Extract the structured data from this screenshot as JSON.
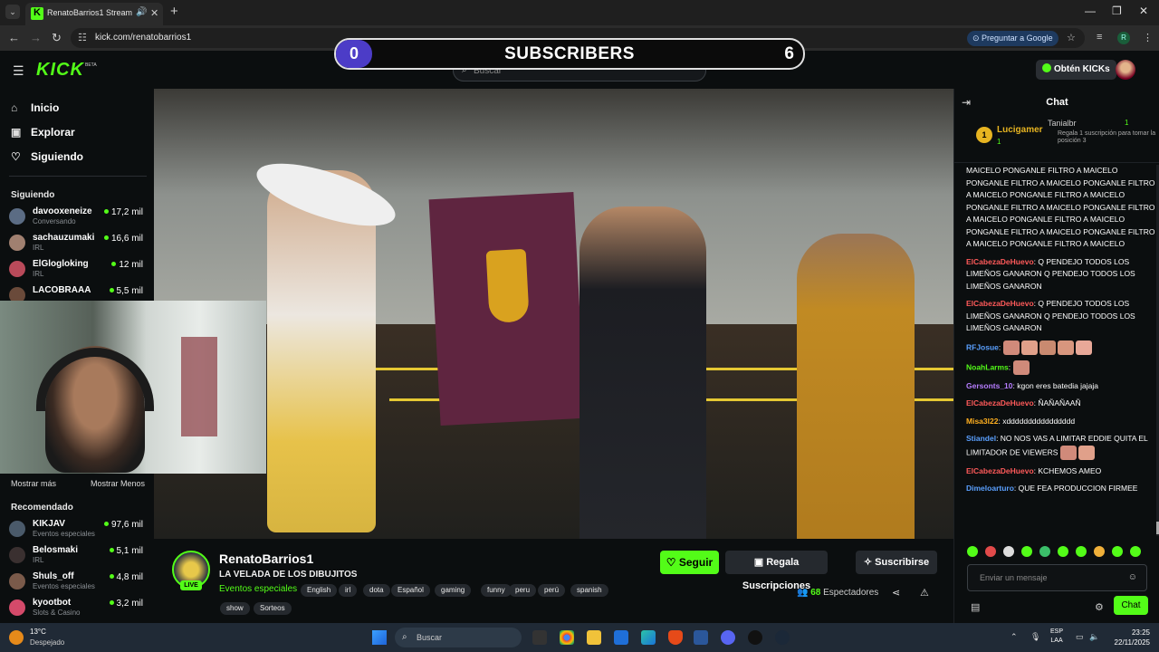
{
  "browser": {
    "tab_title": "RenatoBarrios1 Stream - W",
    "url": "kick.com/renatobarrios1",
    "google_button": "Preguntar a Google",
    "profile_initial": "R"
  },
  "header": {
    "logo": "KICK",
    "logo_badge": "BETA",
    "search_placeholder": "Buscar",
    "kicks_button": "Obtén KICKs"
  },
  "subscriber_goal": {
    "current": "0",
    "label": "SUBSCRIBERS",
    "goal": "6"
  },
  "sidebar": {
    "nav": [
      {
        "label": "Inicio",
        "icon": "home-icon"
      },
      {
        "label": "Explorar",
        "icon": "compass-icon"
      },
      {
        "label": "Siguiendo",
        "icon": "heart-icon"
      }
    ],
    "following_title": "Siguiendo",
    "following": [
      {
        "name": "davooxeneize",
        "category": "Conversando",
        "viewers": "17,2 mil",
        "color": "#5b6c84"
      },
      {
        "name": "sachauzumaki",
        "category": "IRL",
        "viewers": "16,6 mil",
        "color": "#a08070"
      },
      {
        "name": "ElGlogloking",
        "category": "IRL",
        "viewers": "12 mil",
        "color": "#b94a5a"
      },
      {
        "name": "LACOBRAAA",
        "category": "",
        "viewers": "5,5 mil",
        "color": "#6a4a3a"
      }
    ],
    "show_more": "Mostrar más",
    "show_less": "Mostrar Menos",
    "recommended_title": "Recomendado",
    "recommended": [
      {
        "name": "KIKJAV",
        "category": "Eventos especiales",
        "viewers": "97,6 mil",
        "color": "#4a5a6a"
      },
      {
        "name": "Belosmaki",
        "category": "IRL",
        "viewers": "5,1 mil",
        "color": "#3a3030"
      },
      {
        "name": "Shuls_off",
        "category": "Eventos especiales",
        "viewers": "4,8 mil",
        "color": "#7a5a4a"
      },
      {
        "name": "kyootbot",
        "category": "Slots & Casino",
        "viewers": "3,2 mil",
        "color": "#d44a6a"
      }
    ]
  },
  "stream": {
    "channel": "RenatoBarrios1",
    "live": "LIVE",
    "title": "LA VELADA DE LOS DIBUJITOS",
    "category": "Eventos especiales",
    "tags": [
      "English",
      "irl",
      "dota",
      "Español",
      "gaming",
      "funny",
      "peru",
      "perú",
      "spanish",
      "show",
      "Sorteos"
    ],
    "follow_button": "Seguir",
    "gift_button": "Regala Suscripciones",
    "subscribe_button": "Suscribirse",
    "viewer_count": "68",
    "viewer_label": "Espectadores"
  },
  "chat": {
    "title": "Chat",
    "pinned": {
      "rank": "1",
      "top_user": "Lucigamer",
      "top_count": "1",
      "second_user": "Tanialbr",
      "second_count": "1",
      "second_text": "Regala 1 suscripción para tomar la posición 3"
    },
    "messages": [
      {
        "user": "",
        "color": "#ffffff",
        "text": "MAICELO PONGANLE FILTRO A MAICELO PONGANLE FILTRO A MAICELO PONGANLE FILTRO A MAICELO PONGANLE FILTRO A MAICELO PONGANLE FILTRO A MAICELO PONGANLE FILTRO A MAICELO PONGANLE FILTRO A MAICELO PONGANLE FILTRO A MAICELO PONGANLE FILTRO A MAICELO PONGANLE FILTRO A MAICELO"
      },
      {
        "user": "ElCabezaDeHuevo",
        "color": "#ff5a5a",
        "text": "Q PENDEJO TODOS LOS LIMEÑOS GANARON Q PENDEJO TODOS LOS LIMEÑOS GANARON"
      },
      {
        "user": "ElCabezaDeHuevo",
        "color": "#ff5a5a",
        "text": "Q PENDEJO TODOS LOS LIMEÑOS GANARON Q PENDEJO TODOS LOS LIMEÑOS GANARON"
      },
      {
        "user": "RFJosue",
        "color": "#5aa0ff",
        "text": "",
        "emotes": 5
      },
      {
        "user": "NoahLarms",
        "color": "#53fc18",
        "text": "",
        "emotes": 1
      },
      {
        "user": "Gersonts_10",
        "color": "#b67dff",
        "text": "kgon eres batedia jajaja"
      },
      {
        "user": "ElCabezaDeHuevo",
        "color": "#ff5a5a",
        "text": "ÑAÑAÑAAÑ"
      },
      {
        "user": "Misa3l22",
        "color": "#ffb020",
        "text": "xdddddddddddddddd"
      },
      {
        "user": "Stiandel",
        "color": "#5aa0ff",
        "text": "NO NOS VAS A LIMITAR EDDIE QUITA EL LIMITADOR DE VIEWERS",
        "emotes": 2
      },
      {
        "user": "ElCabezaDeHuevo",
        "color": "#ff5a5a",
        "text": "KCHEMOS AMEO"
      },
      {
        "user": "Dimeloarturo",
        "color": "#5aa0ff",
        "text": "QUE FEA PRODUCCION FIRMEE"
      }
    ],
    "input_placeholder": "Enviar un mensaje",
    "send_button": "Chat"
  },
  "taskbar": {
    "temperature": "13°C",
    "weather": "Despejado",
    "search": "Buscar",
    "lang_top": "ESP",
    "lang_bottom": "LAA",
    "time": "23:25",
    "date": "22/11/2025"
  }
}
